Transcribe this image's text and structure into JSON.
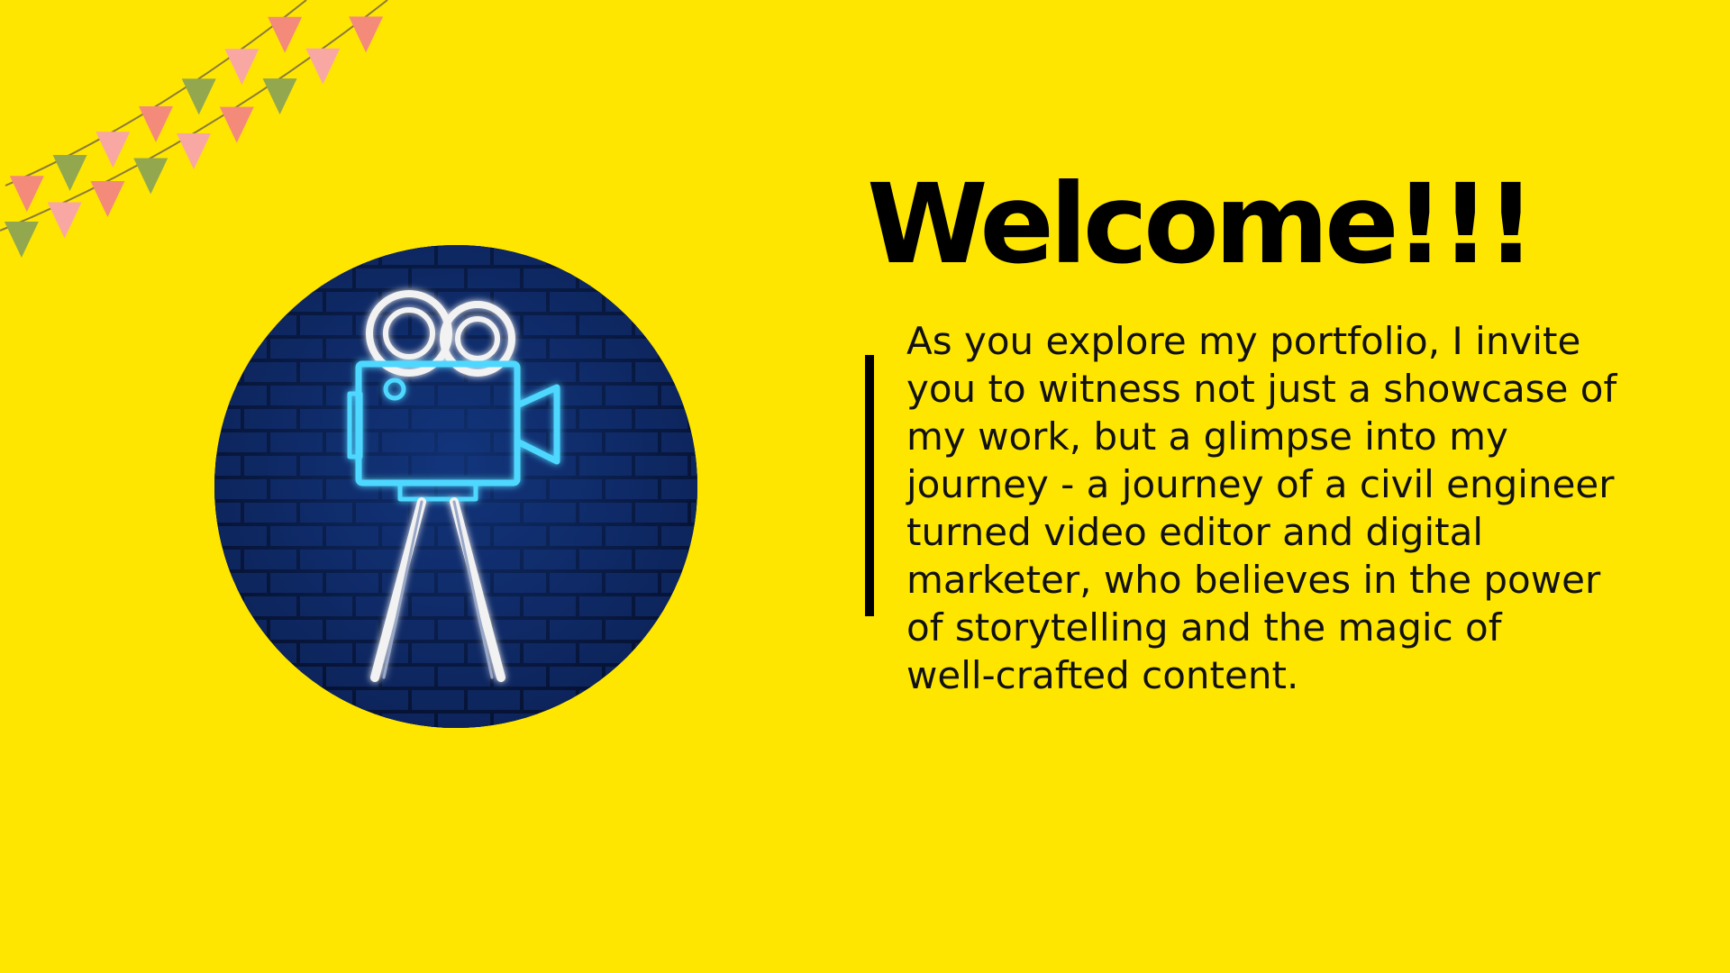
{
  "slide": {
    "background_color": "#ffe600",
    "title": "Welcome!!!",
    "body_lines": [
      "As you explore my portfolio, I invite",
      "you to witness not just a showcase of",
      "my work, but a glimpse into my",
      "journey - a journey of a civil engineer",
      "turned video editor and digital",
      "marketer, who believes in the power",
      "of storytelling and the magic of",
      "well-crafted content."
    ]
  },
  "decorations": {
    "bunting": {
      "icon": "bunting-flags-icon",
      "colors": [
        "#f48a7a",
        "#93a84e",
        "#f9a7a3"
      ]
    },
    "image": {
      "icon": "neon-movie-camera-icon",
      "colors": {
        "background": "#0a1a45",
        "brick": "#163a8a",
        "neon_blue": "#4fd8ff",
        "neon_white": "#f2f2f2"
      }
    }
  }
}
